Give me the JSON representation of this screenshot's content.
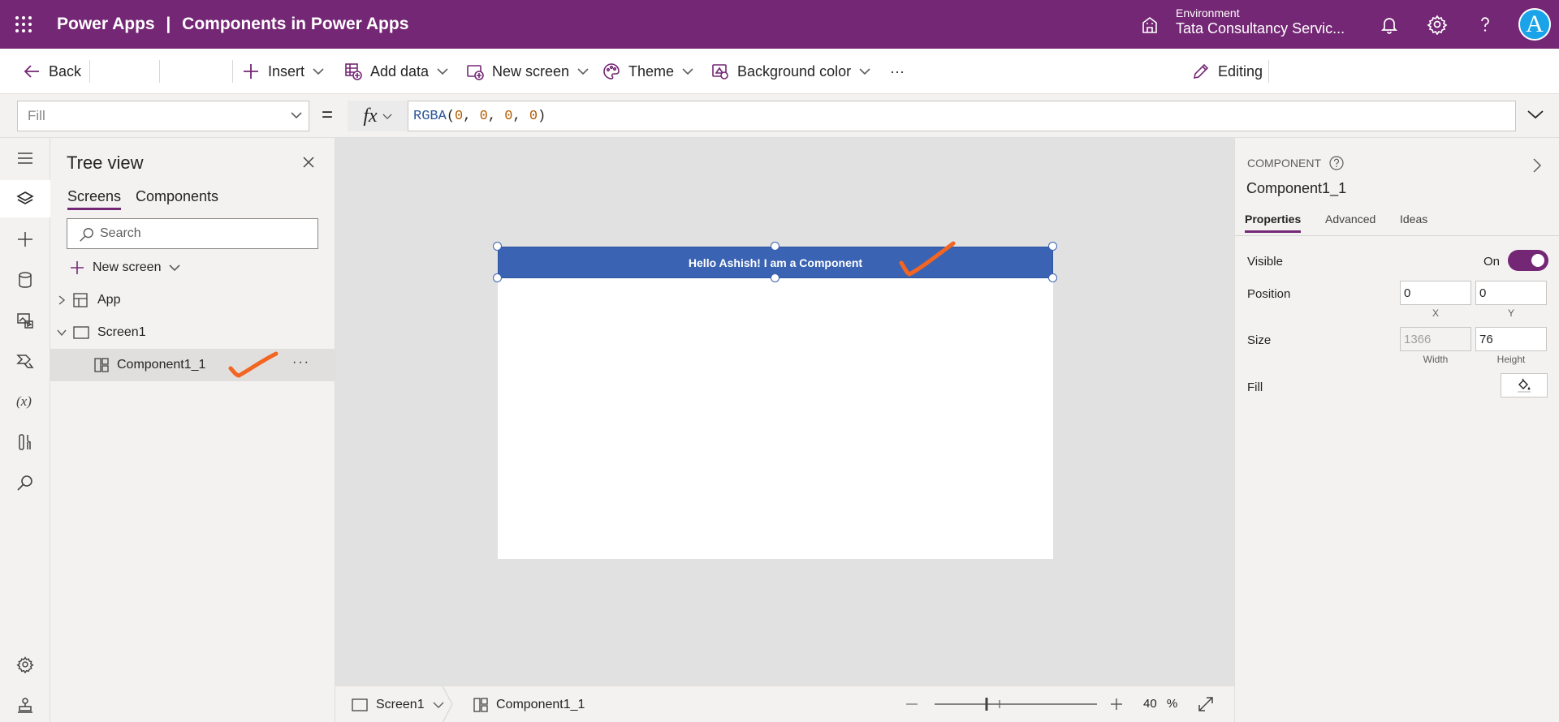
{
  "header": {
    "app_name": "Power Apps",
    "separator": "|",
    "app_title": "Components in Power Apps",
    "environment_label": "Environment",
    "environment_value": "Tata Consultancy Servic...",
    "avatar_initial": "A",
    "brand_color": "#742774"
  },
  "toolbar": {
    "back_label": "Back",
    "insert_label": "Insert",
    "add_data_label": "Add data",
    "new_screen_label": "New screen",
    "theme_label": "Theme",
    "background_color_label": "Background color",
    "more_label": "···",
    "editing_label": "Editing"
  },
  "formula_bar": {
    "property": "Fill",
    "equals": "=",
    "fx": "fx",
    "formula_fn": "RGBA",
    "formula_args": [
      "0",
      "0",
      "0",
      "0"
    ]
  },
  "tree_view": {
    "title": "Tree view",
    "tabs": [
      {
        "label": "Screens",
        "active": true
      },
      {
        "label": "Components",
        "active": false
      }
    ],
    "search_placeholder": "Search",
    "new_screen_label": "New screen",
    "items": [
      {
        "label": "App",
        "level": 0,
        "selected": false
      },
      {
        "label": "Screen1",
        "level": 0,
        "selected": false
      },
      {
        "label": "Component1_1",
        "level": 1,
        "selected": true
      }
    ],
    "row_more": "···"
  },
  "canvas": {
    "component_text": "Hello Ashish! I am a Component",
    "component_color": "#3a63b3"
  },
  "statusbar": {
    "screen_crumb": "Screen1",
    "component_crumb": "Component1_1",
    "zoom_value": "40",
    "zoom_unit": "%",
    "zoom_level": 0.4
  },
  "properties": {
    "caption": "COMPONENT",
    "name": "Component1_1",
    "tabs": [
      {
        "label": "Properties",
        "active": true
      },
      {
        "label": "Advanced",
        "active": false
      },
      {
        "label": "Ideas",
        "active": false
      }
    ],
    "visible_label": "Visible",
    "visible_state": "On",
    "position_label": "Position",
    "x_value": "0",
    "y_value": "0",
    "x_sub": "X",
    "y_sub": "Y",
    "size_label": "Size",
    "width_value": "1366",
    "height_value": "76",
    "width_sub": "Width",
    "height_sub": "Height",
    "fill_label": "Fill"
  },
  "annotation_color": "#f26522"
}
